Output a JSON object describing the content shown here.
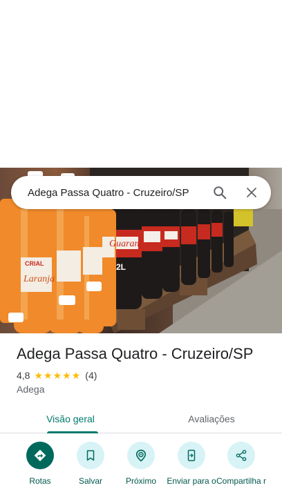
{
  "search": {
    "query": "Adega Passa Quatro - Cruzeiro/SP"
  },
  "place": {
    "title": "Adega Passa Quatro - Cruzeiro/SP",
    "rating": "4,8",
    "stars": 5,
    "review_count": "(4)",
    "category": "Adega"
  },
  "tabs": [
    {
      "label": "Visão geral",
      "active": true
    },
    {
      "label": "Avaliações",
      "active": false
    }
  ],
  "actions": [
    {
      "label": "Rotas",
      "icon": "directions-icon"
    },
    {
      "label": "Salvar",
      "icon": "bookmark-icon"
    },
    {
      "label": "Próximo",
      "icon": "nearby-icon"
    },
    {
      "label": "Enviar para o",
      "icon": "send-to-phone-icon"
    },
    {
      "label": "Compartilha r",
      "icon": "share-icon"
    }
  ],
  "photo": {
    "bottle_labels": [
      "CRIAL",
      "Laranja",
      "Guaraná",
      "2L"
    ]
  },
  "colors": {
    "accent": "#00796b",
    "primary_action": "#00695c",
    "action_bg": "#d7f3f6",
    "star": "#fbbc04"
  }
}
